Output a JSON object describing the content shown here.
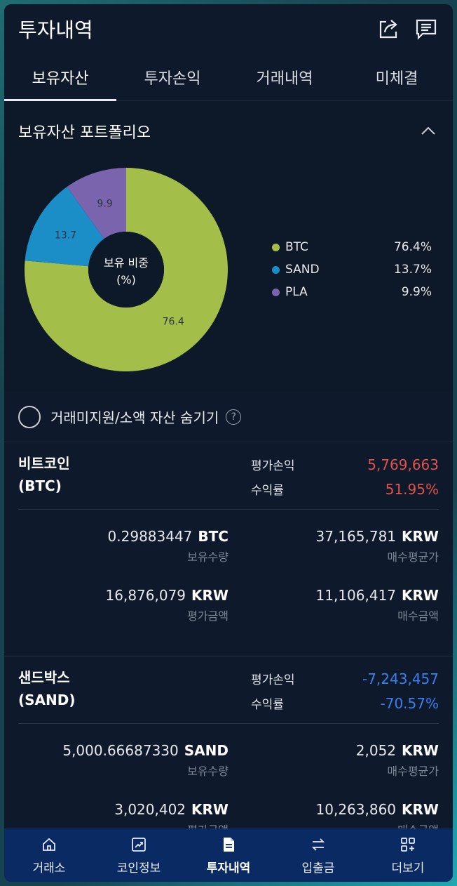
{
  "header": {
    "title": "투자내역",
    "icons": [
      "share-icon",
      "message-icon"
    ]
  },
  "tabs": [
    {
      "label": "보유자산",
      "active": true
    },
    {
      "label": "투자손익",
      "active": false
    },
    {
      "label": "거래내역",
      "active": false
    },
    {
      "label": "미체결",
      "active": false
    }
  ],
  "portfolio": {
    "title": "보유자산 포트폴리오",
    "center_line1": "보유 비중",
    "center_line2": "(%)",
    "legend": [
      {
        "name": "BTC",
        "value": "76.4%",
        "color": "#a3bf4a"
      },
      {
        "name": "SAND",
        "value": "13.7%",
        "color": "#1b8ec8"
      },
      {
        "name": "PLA",
        "value": "9.9%",
        "color": "#7a64ad"
      }
    ]
  },
  "chart_data": {
    "type": "pie",
    "categories": [
      "BTC",
      "SAND",
      "PLA"
    ],
    "values": [
      76.4,
      13.7,
      9.9
    ],
    "data_labels": [
      "76.4",
      "13.7",
      "9.9"
    ],
    "colors": [
      "#a3bf4a",
      "#1b8ec8",
      "#7a64ad"
    ],
    "donut": true
  },
  "hide_option": {
    "label": "거래미지원/소액 자산 숨기기",
    "help": "?"
  },
  "labels": {
    "pl": "평가손익",
    "rate": "수익률",
    "holding_qty": "보유수량",
    "avg_price": "매수평균가",
    "eval_amount": "평가금액",
    "buy_amount": "매수금액"
  },
  "assets": [
    {
      "name_line1": "비트코인",
      "name_line2": "(BTC)",
      "pl": "5,769,663",
      "rate": "51.95%",
      "sign": "positive",
      "qty": "0.29883447",
      "qty_unit": "BTC",
      "avg": "37,165,781",
      "avg_unit": "KRW",
      "eval": "16,876,079",
      "eval_unit": "KRW",
      "buy": "11,106,417",
      "buy_unit": "KRW"
    },
    {
      "name_line1": "샌드박스",
      "name_line2": "(SAND)",
      "pl": "-7,243,457",
      "rate": "-70.57%",
      "sign": "negative",
      "qty": "5,000.66687330",
      "qty_unit": "SAND",
      "avg": "2,052",
      "avg_unit": "KRW",
      "eval": "3,020,402",
      "eval_unit": "KRW",
      "buy": "10,263,860",
      "buy_unit": "KRW"
    }
  ],
  "bottom_nav": [
    {
      "label": "거래소",
      "icon": "home-icon",
      "active": false
    },
    {
      "label": "코인정보",
      "icon": "chart-icon",
      "active": false
    },
    {
      "label": "투자내역",
      "icon": "document-icon",
      "active": true
    },
    {
      "label": "입출금",
      "icon": "transfer-icon",
      "active": false
    },
    {
      "label": "더보기",
      "icon": "more-grid-icon",
      "active": false
    }
  ]
}
